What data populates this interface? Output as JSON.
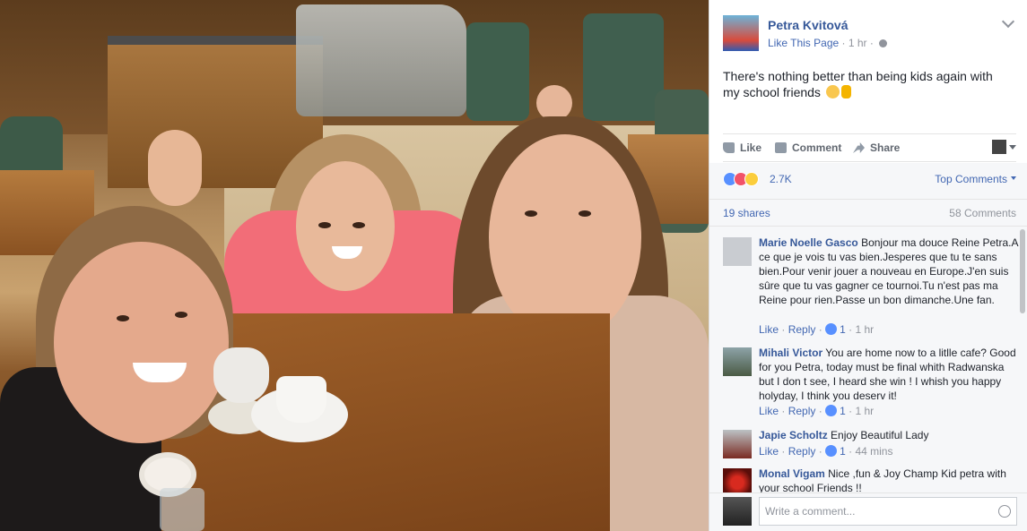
{
  "post": {
    "page_name": "Petra Kvitová",
    "like_page": "Like This Page",
    "time": "· 1 hr ·",
    "text": "There's nothing better than being kids again with my school friends"
  },
  "actions": {
    "like": "Like",
    "comment": "Comment",
    "share": "Share"
  },
  "stats": {
    "reactions": "2.7K",
    "sort": "Top Comments",
    "shares": "19 shares",
    "comments_count": "58 Comments"
  },
  "comments": [
    {
      "name": "Marie Noelle Gasco",
      "text": "Bonjour ma douce Reine Petra.A ce que je vois tu vas bien.Jesperes que tu te sans bien.Pour venir jouer a nouveau en Europe.J'en suis sûre que tu vas gagner ce tournoi.Tu n'est pas ma Reine pour rien.Passe un bon dimanche.Une fan.",
      "like": "Like",
      "reply": "Reply",
      "likes": "1",
      "time": "1 hr"
    },
    {
      "name": "Mihali Victor",
      "text": "You are home now to a litlle cafe? Good for you Petra, today must be final whith Radwanska but I don t see, I heard she win ! I whish you happy holyday, I think you deserv it!",
      "like": "Like",
      "reply": "Reply",
      "likes": "1",
      "time": "1 hr"
    },
    {
      "name": "Japie Scholtz",
      "text": "Enjoy Beautiful Lady",
      "like": "Like",
      "reply": "Reply",
      "likes": "1",
      "time": "44 mins"
    },
    {
      "name": "Monal Vigam",
      "text": "Nice ,fun & Joy Champ Kid petra with your school Friends !!"
    }
  ],
  "composer": {
    "placeholder": "Write a comment..."
  },
  "sep": "·"
}
